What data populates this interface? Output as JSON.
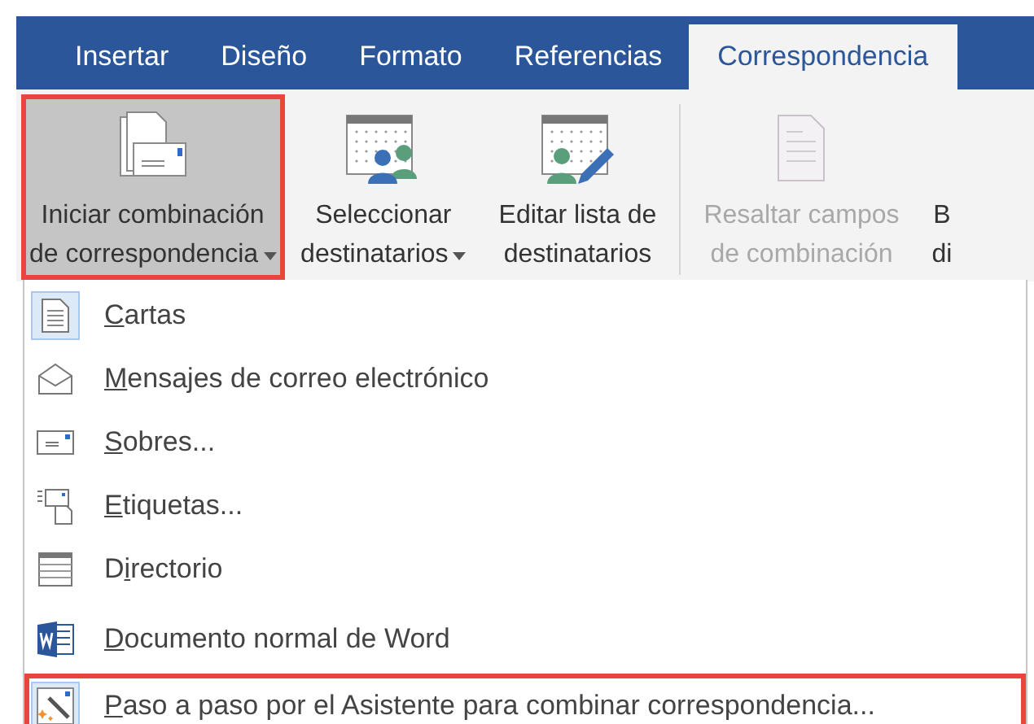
{
  "tabs": [
    {
      "label": "Insertar",
      "selected": false
    },
    {
      "label": "Diseño",
      "selected": false
    },
    {
      "label": "Formato",
      "selected": false
    },
    {
      "label": "Referencias",
      "selected": false
    },
    {
      "label": "Correspondencia",
      "selected": true
    }
  ],
  "ribbon": [
    {
      "kind": "start",
      "lines": [
        "Iniciar combinación",
        "de correspondencia"
      ],
      "dropdown": true,
      "pressed": true,
      "highlighted": true,
      "disabled": false
    },
    {
      "kind": "recipients",
      "lines": [
        "Seleccionar",
        "destinatarios"
      ],
      "dropdown": true,
      "pressed": false,
      "highlighted": false,
      "disabled": false
    },
    {
      "kind": "edit",
      "lines": [
        "Editar lista de",
        "destinatarios"
      ],
      "dropdown": false,
      "pressed": false,
      "highlighted": false,
      "disabled": false
    },
    {
      "kind": "fields",
      "lines": [
        "Resaltar campos",
        "de combinación"
      ],
      "dropdown": false,
      "pressed": false,
      "highlighted": false,
      "disabled": true
    },
    {
      "kind": "cut",
      "lines": [
        "B",
        "di"
      ],
      "dropdown": false,
      "pressed": false,
      "highlighted": false,
      "disabled": false
    }
  ],
  "menu": [
    {
      "kind": "letter",
      "key": "C",
      "post": "artas",
      "framed": true,
      "highlighted": false
    },
    {
      "kind": "email",
      "key": "M",
      "post": "ensajes de correo electrónico",
      "framed": false,
      "highlighted": false
    },
    {
      "kind": "envelope",
      "key": "S",
      "post": "obres...",
      "framed": false,
      "highlighted": false
    },
    {
      "kind": "labels",
      "key": "E",
      "post": "tiquetas...",
      "framed": false,
      "highlighted": false
    },
    {
      "kind": "directory",
      "pre": "D",
      "key": "i",
      "post": "rectorio",
      "framed": false,
      "highlighted": false
    },
    {
      "kind": "separator"
    },
    {
      "kind": "word",
      "key": "D",
      "post": "ocumento normal de Word",
      "framed": false,
      "highlighted": false
    },
    {
      "kind": "wizard",
      "key": "P",
      "post": "aso a paso por el Asistente para combinar correspondencia...",
      "framed": true,
      "highlighted": true
    }
  ]
}
